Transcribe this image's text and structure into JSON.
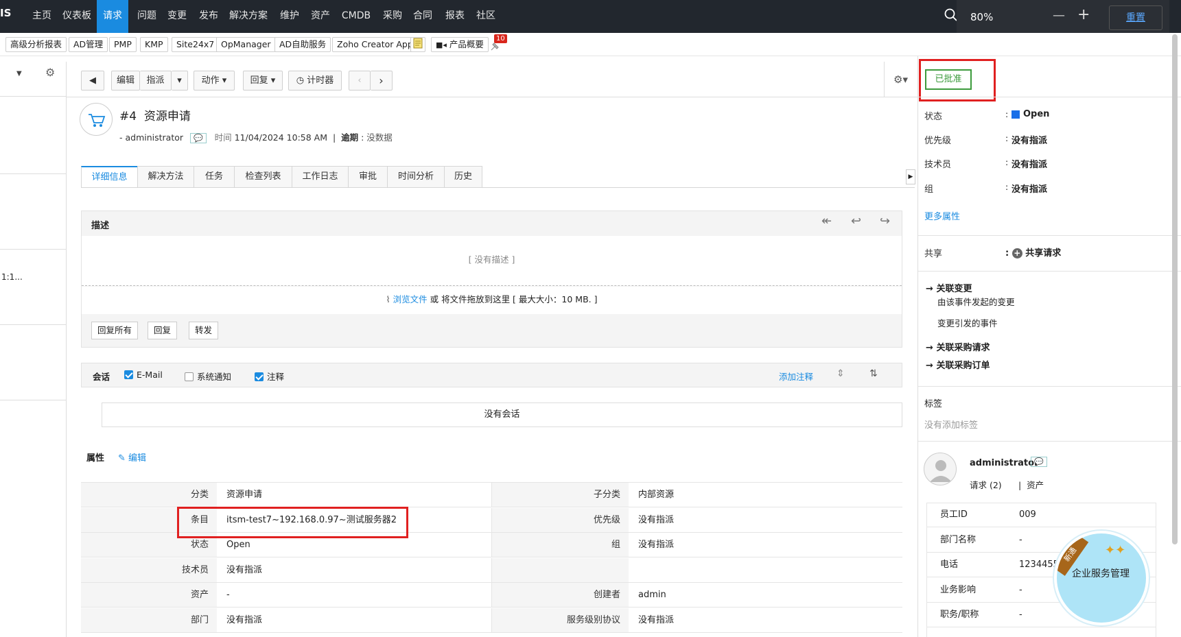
{
  "topnav": {
    "logo": "IS",
    "items": [
      "主页",
      "仪表板",
      "请求",
      "问题",
      "变更",
      "发布",
      "解决方案",
      "维护",
      "资产",
      "CMDB",
      "采购",
      "合同",
      "报表",
      "社区"
    ],
    "active_index": 2
  },
  "zoom": {
    "level": "80%",
    "minus": "—",
    "plus": "+",
    "reset": "重置"
  },
  "quickbar": {
    "items": [
      "高级分析报表",
      "AD管理",
      "PMP",
      "KMP",
      "Site24x7",
      "OpManager",
      "AD自助服务",
      "Zoho Creator App"
    ],
    "product_overview": "产品概要",
    "badge_count": "10"
  },
  "left_panel": {
    "text_1": "1:1..."
  },
  "toolbar": {
    "edit": "编辑",
    "assign": "指派",
    "actions": "动作",
    "reply": "回复",
    "timer": "计时器"
  },
  "request": {
    "id": "#4",
    "title": "资源申请",
    "requester": "- administrator",
    "time_label": "时间",
    "time_value": "11/04/2024 10:58 AM",
    "due_label": "逾期",
    "due_value": "没数据"
  },
  "tabs": [
    "详细信息",
    "解决方法",
    "任务",
    "检查列表",
    "工作日志",
    "审批",
    "时间分析",
    "历史"
  ],
  "description": {
    "label": "描述",
    "empty": "[ 没有描述 ]",
    "browse_link": "浏览文件",
    "drop_text": "或 将文件拖放到这里 [ 最大大小：10 MB. ]",
    "buttons": [
      "回复所有",
      "回复",
      "转发"
    ]
  },
  "conversation": {
    "label": "会话",
    "filters": [
      {
        "label": "E-Mail",
        "checked": true
      },
      {
        "label": "系统通知",
        "checked": false
      },
      {
        "label": "注释",
        "checked": true
      }
    ],
    "add_note": "添加注释",
    "empty": "没有会话"
  },
  "properties": {
    "label": "属性",
    "edit": "编辑",
    "rows": [
      {
        "l1": "分类",
        "v1": "资源申请",
        "l2": "子分类",
        "v2": "内部资源"
      },
      {
        "l1": "条目",
        "v1": "itsm-test7~192.168.0.97~测试服务器2",
        "l2": "优先级",
        "v2": "没有指派"
      },
      {
        "l1": "状态",
        "v1": "Open",
        "l2": "组",
        "v2": "没有指派"
      },
      {
        "l1": "技术员",
        "v1": "没有指派",
        "l2": "",
        "v2": ""
      },
      {
        "l1": "资产",
        "v1": "-",
        "l2": "创建者",
        "v2": "admin"
      },
      {
        "l1": "部门",
        "v1": "没有指派",
        "l2": "服务级别协议",
        "v2": "没有指派"
      }
    ]
  },
  "right_panel": {
    "approved": "已批准",
    "fields": [
      {
        "label": "状态",
        "value": "Open"
      },
      {
        "label": "优先级",
        "value": "没有指派"
      },
      {
        "label": "技术员",
        "value": "没有指派"
      },
      {
        "label": "组",
        "value": "没有指派"
      }
    ],
    "more_props": "更多属性",
    "share_label": "共享",
    "share_value": "共享请求",
    "assoc_change": "关联变更",
    "change_from_incident": "由该事件发起的变更",
    "incident_from_change": "变更引发的事件",
    "assoc_po_req": "关联采购请求",
    "assoc_po": "关联采购订单",
    "tags_label": "标签",
    "tags_empty": "没有添加标签",
    "user_name": "administrator",
    "user_requests": "请求 (2)",
    "user_assets": "资产",
    "employee": [
      {
        "label": "员工ID",
        "value": "009"
      },
      {
        "label": "部门名称",
        "value": "-"
      },
      {
        "label": "电话",
        "value": "1234455"
      },
      {
        "label": "业务影响",
        "value": "-"
      },
      {
        "label": "职务/职称",
        "value": "-"
      }
    ]
  },
  "badge_circle": {
    "ribbon": "新通",
    "text": "企业服务管理"
  },
  "colors": {
    "accent": "#1a8be0",
    "topbar": "#22272e",
    "approved": "#3c9a3c",
    "highlight": "#e02020"
  }
}
